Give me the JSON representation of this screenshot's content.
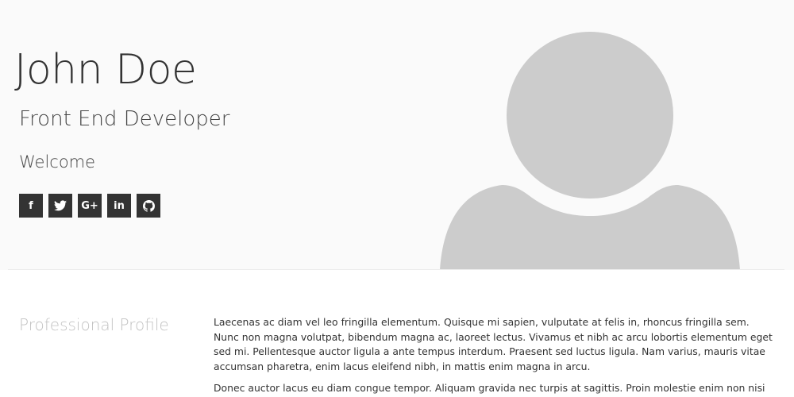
{
  "header": {
    "name": "John Doe",
    "role": "Front End Developer",
    "welcome": "Welcome"
  },
  "social": [
    {
      "label": "f",
      "icon": "facebook-icon"
    },
    {
      "label": "",
      "icon": "twitter-icon"
    },
    {
      "label": "G+",
      "icon": "google-plus-icon"
    },
    {
      "label": "in",
      "icon": "linkedin-icon"
    },
    {
      "label": "",
      "icon": "github-icon"
    }
  ],
  "profile": {
    "title": "Professional Profile",
    "paragraphs": [
      "Laecenas ac diam vel leo fringilla elementum. Quisque mi sapien, vulputate at felis in, rhoncus fringilla sem. Nunc non magna volutpat, bibendum magna ac, laoreet lectus. Vivamus et nibh ac arcu lobortis elementum eget sed mi. Pellentesque auctor ligula a ante tempus interdum. Praesent sed luctus ligula. Nam varius, mauris vitae accumsan pharetra, enim lacus eleifend nibh, in mattis enim magna in arcu.",
      "Donec auctor lacus eu diam congue tempor. Aliquam gravida nec turpis at sagittis. Proin molestie enim non nisi"
    ]
  },
  "colors": {
    "background": "#fafafa",
    "text": "#333333",
    "button": "#333333",
    "avatar": "#cccccc",
    "section_title": "#c2c2c2"
  }
}
